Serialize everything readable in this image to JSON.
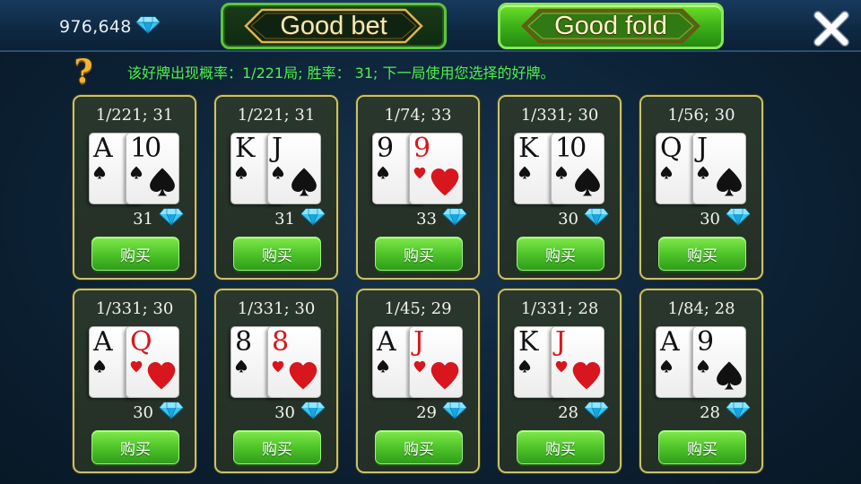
{
  "header": {
    "balance": "976,648",
    "balance_icon": "diamond-icon",
    "good_bet_label": "Good bet",
    "good_fold_label": "Good fold",
    "close_icon": "close-icon"
  },
  "info": {
    "text": "该好牌出现概率：1/221局;  胜率：  31; 下一局使用您选择的好牌。",
    "help_icon": "question-mark-icon"
  },
  "colors": {
    "info_text": "#4ff04a",
    "panel_border": "#c9c26a",
    "buy_button": "#4fc52a",
    "red_suit": "#d8161d",
    "diamond": "#39c6f0"
  },
  "cards": [
    {
      "odds": "1/221;  31",
      "hand": [
        {
          "rank": "A",
          "suit": "spade"
        },
        {
          "rank": "10",
          "suit": "spade"
        }
      ],
      "price": "31",
      "buy_label": "购买"
    },
    {
      "odds": "1/221;  31",
      "hand": [
        {
          "rank": "K",
          "suit": "spade"
        },
        {
          "rank": "J",
          "suit": "spade"
        }
      ],
      "price": "31",
      "buy_label": "购买"
    },
    {
      "odds": "1/74;  33",
      "hand": [
        {
          "rank": "9",
          "suit": "spade"
        },
        {
          "rank": "9",
          "suit": "heart"
        }
      ],
      "price": "33",
      "buy_label": "购买"
    },
    {
      "odds": "1/331;  30",
      "hand": [
        {
          "rank": "K",
          "suit": "spade"
        },
        {
          "rank": "10",
          "suit": "spade"
        }
      ],
      "price": "30",
      "buy_label": "购买"
    },
    {
      "odds": "1/56;  30",
      "hand": [
        {
          "rank": "Q",
          "suit": "spade"
        },
        {
          "rank": "J",
          "suit": "spade"
        }
      ],
      "price": "30",
      "buy_label": "购买"
    },
    {
      "odds": "1/331;  30",
      "hand": [
        {
          "rank": "A",
          "suit": "spade"
        },
        {
          "rank": "Q",
          "suit": "heart"
        }
      ],
      "price": "30",
      "buy_label": "购买"
    },
    {
      "odds": "1/331;  30",
      "hand": [
        {
          "rank": "8",
          "suit": "spade"
        },
        {
          "rank": "8",
          "suit": "heart"
        }
      ],
      "price": "30",
      "buy_label": "购买"
    },
    {
      "odds": "1/45;  29",
      "hand": [
        {
          "rank": "A",
          "suit": "spade"
        },
        {
          "rank": "J",
          "suit": "heart"
        }
      ],
      "price": "29",
      "buy_label": "购买"
    },
    {
      "odds": "1/331;  28",
      "hand": [
        {
          "rank": "K",
          "suit": "spade"
        },
        {
          "rank": "J",
          "suit": "heart"
        }
      ],
      "price": "28",
      "buy_label": "购买"
    },
    {
      "odds": "1/84;  28",
      "hand": [
        {
          "rank": "A",
          "suit": "spade"
        },
        {
          "rank": "9",
          "suit": "spade"
        }
      ],
      "price": "28",
      "buy_label": "购买"
    }
  ]
}
